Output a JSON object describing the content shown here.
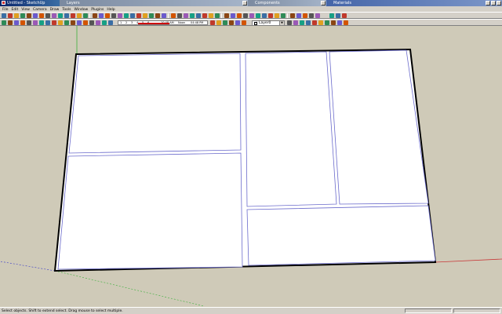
{
  "window": {
    "title": "Untitled - SketchUp",
    "dialogs": [
      "Layers",
      "Components",
      "Materials"
    ]
  },
  "menu": [
    "File",
    "Edit",
    "View",
    "Camera",
    "Draw",
    "Tools",
    "Window",
    "Plugins",
    "Help"
  ],
  "toolbar": {
    "ruler_ticks": [
      "1",
      "2",
      "3",
      "4",
      "5",
      "6"
    ],
    "ruler_label_left": "10:48 AM",
    "ruler_label_noon": "Noon",
    "ruler_label_right": "04:48 PM",
    "layer": "Layer0"
  },
  "status": {
    "message": "Select objects. Shift to extend select. Drag mouse to select multiple.",
    "measurements_label": "",
    "measurements_value": ""
  },
  "colors": {
    "sky_ground": "#cfcab8",
    "face": "#ffffff",
    "edge": "#000000",
    "axis_red": "#c83a3a",
    "axis_green": "#3ab03a",
    "axis_blue": "#3a3ac8",
    "selection_blue": "#5555ff"
  },
  "icons": [
    "new-icon",
    "open-icon",
    "save-icon",
    "cut-icon",
    "copy-icon",
    "paste-icon",
    "erase-icon",
    "undo-icon",
    "redo-icon",
    "print-icon",
    "select-icon",
    "make-component-icon",
    "paint-bucket-icon",
    "eraser-icon",
    "rectangle-icon",
    "line-icon",
    "circle-icon",
    "arc-icon",
    "polygon-icon",
    "freehand-icon",
    "move-icon",
    "push-pull-icon",
    "rotate-icon",
    "follow-me-icon",
    "scale-icon",
    "offset-icon",
    "tape-measure-icon",
    "dimension-icon",
    "protractor-icon",
    "text-icon",
    "axes-icon",
    "3d-text-icon",
    "orbit-icon",
    "pan-icon",
    "zoom-icon",
    "zoom-window-icon",
    "zoom-extents-icon",
    "previous-icon",
    "next-icon",
    "position-camera-icon",
    "walk-icon",
    "look-around-icon",
    "section-plane-icon"
  ]
}
